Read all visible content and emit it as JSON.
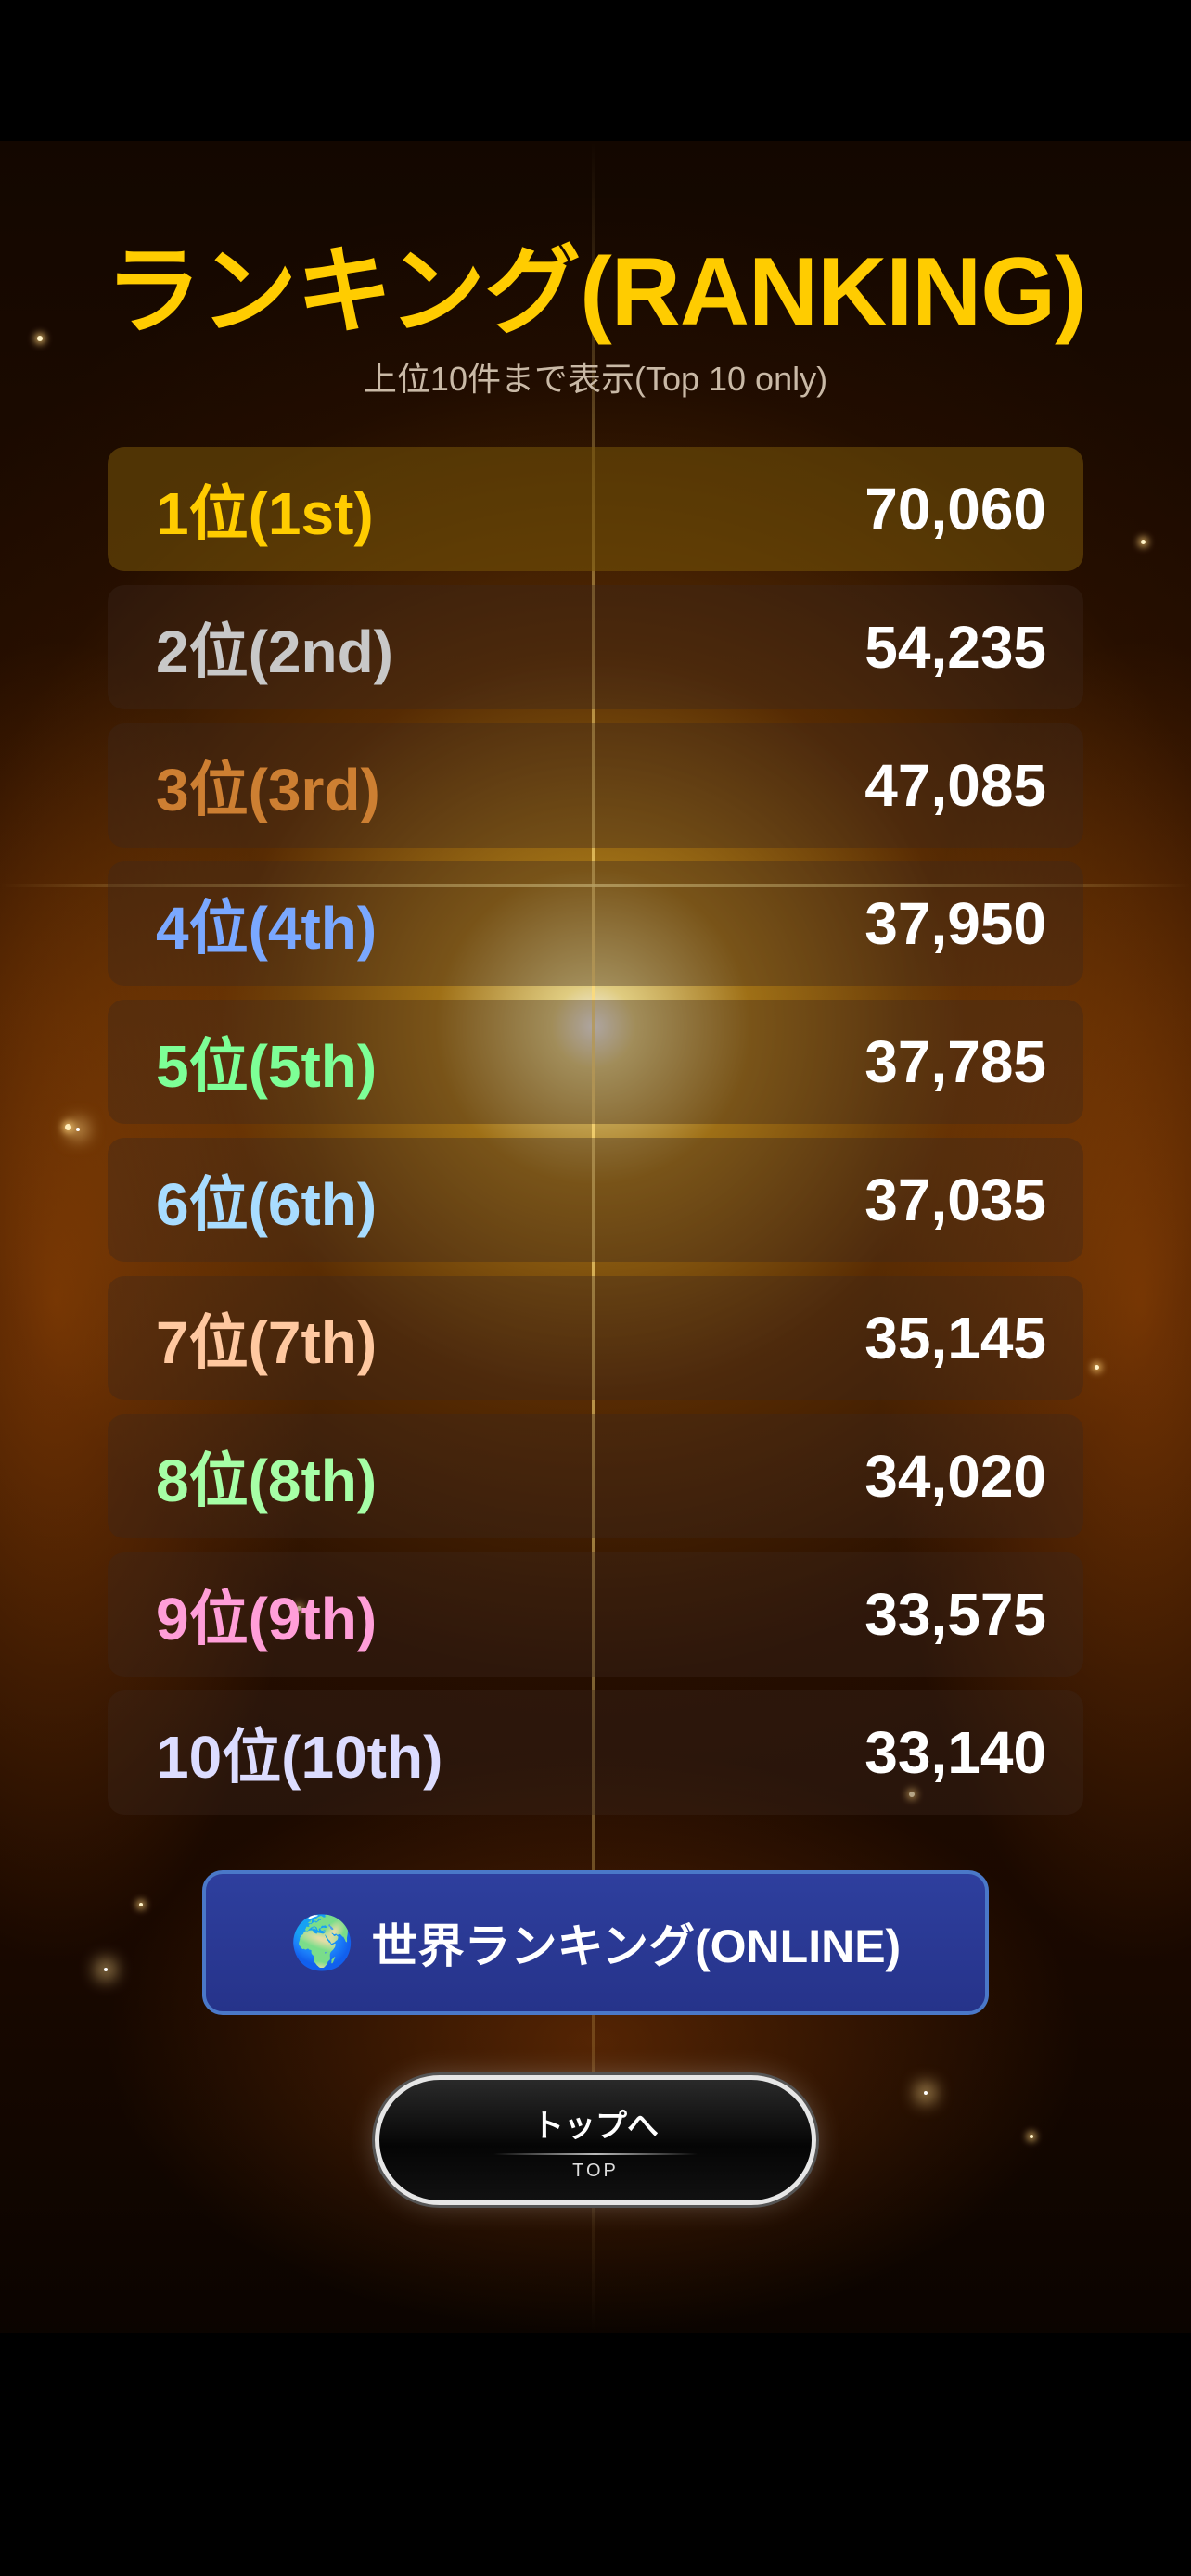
{
  "page": {
    "title": "ランキング(RANKING)",
    "subtitle": "上位10件まで表示(Top 10 only)"
  },
  "rankings": [
    {
      "label": "1位(1st)",
      "score": "70,060",
      "color": "#ffcc00"
    },
    {
      "label": "2位(2nd)",
      "score": "54,235",
      "color": "#c8c8c8"
    },
    {
      "label": "3位(3rd)",
      "score": "47,085",
      "color": "#cd7f32"
    },
    {
      "label": "4位(4th)",
      "score": "37,950",
      "color": "#7aa8ff"
    },
    {
      "label": "5位(5th)",
      "score": "37,785",
      "color": "#7dff96"
    },
    {
      "label": "6位(6th)",
      "score": "37,035",
      "color": "#a8dcff"
    },
    {
      "label": "7位(7th)",
      "score": "35,145",
      "color": "#ffc8a0"
    },
    {
      "label": "8位(8th)",
      "score": "34,020",
      "color": "#a6ffa6"
    },
    {
      "label": "9位(9th)",
      "score": "33,575",
      "color": "#ff9ed8"
    },
    {
      "label": "10位(10th)",
      "score": "33,140",
      "color": "#dcdcff"
    }
  ],
  "buttons": {
    "world": {
      "icon": "globe-icon",
      "glyph": "🌍",
      "label": "世界ランキング(ONLINE)"
    },
    "top": {
      "label": "トップへ",
      "sublabel": "TOP"
    }
  },
  "colors": {
    "title": "#ffcc00",
    "world_button": "#2e3f9e",
    "world_border": "#4a78c8"
  }
}
